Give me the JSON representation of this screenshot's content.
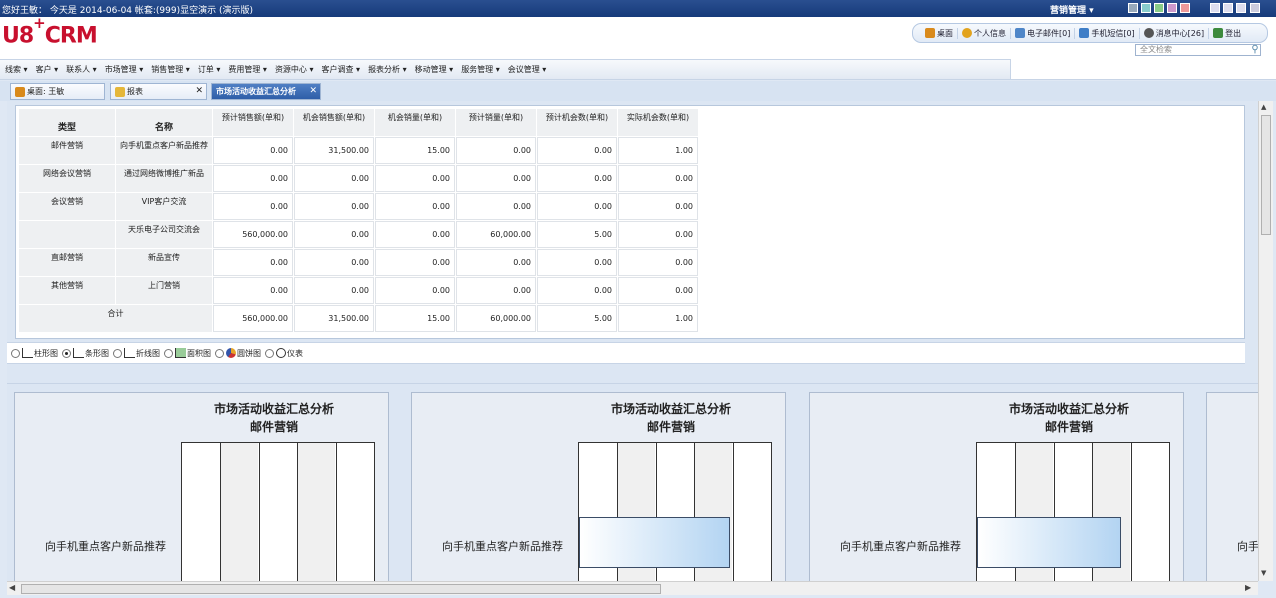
{
  "titlebar": {
    "welcome": "您好王敏：  今天是  2014-06-04 帐套:(999)显空演示 (演示版)",
    "mode": "营销管理"
  },
  "header": {
    "logo_a": "U8",
    "logo_plus": "+",
    "logo_b": "CRM",
    "tools": [
      {
        "label": "桌面",
        "icon": "home-icon",
        "color": "#d98a1c"
      },
      {
        "label": "个人信息",
        "icon": "user-icon",
        "color": "#e2a31d"
      },
      {
        "label": "电子邮件[0]",
        "icon": "mail-icon",
        "color": "#4f86c8"
      },
      {
        "label": "手机短信[0]",
        "icon": "phone-icon",
        "color": "#3f7ec7"
      },
      {
        "label": "消息中心[26]",
        "icon": "message-icon",
        "color": "#555555"
      },
      {
        "label": "登出",
        "icon": "logout-icon",
        "color": "#3d8a3d"
      }
    ],
    "search_placeholder": "全文检索"
  },
  "menu": [
    "线索 ▾",
    "客户 ▾",
    "联系人 ▾",
    "市场管理 ▾",
    "销售管理 ▾",
    "订单 ▾",
    "费用管理 ▾",
    "资源中心 ▾",
    "客户调查 ▾",
    "报表分析 ▾",
    "移动管理 ▾",
    "服务管理 ▾",
    "会议管理 ▾"
  ],
  "tabs": [
    {
      "label": "桌面: 王敏"
    },
    {
      "label": "报表"
    },
    {
      "label": "市场活动收益汇总分析"
    }
  ],
  "table": {
    "h_type": "类型",
    "h_name": "名称",
    "columns": [
      "预计销售额(单和)",
      "机会销售额(单和)",
      "机会销量(单和)",
      "预计销量(单和)",
      "预计机会数(单和)",
      "实际机会数(单和)"
    ],
    "rows": [
      {
        "type": "邮件营销",
        "name": "向手机重点客户新品推荐",
        "values": [
          "0.00",
          "31,500.00",
          "15.00",
          "0.00",
          "0.00",
          "1.00"
        ]
      },
      {
        "type": "网络会议营销",
        "name": "通过网络微博推广新品",
        "values": [
          "0.00",
          "0.00",
          "0.00",
          "0.00",
          "0.00",
          "0.00"
        ]
      },
      {
        "type": "会议营销",
        "name": "VIP客户交流",
        "values": [
          "0.00",
          "0.00",
          "0.00",
          "0.00",
          "0.00",
          "0.00"
        ]
      },
      {
        "type": "",
        "name": "天乐电子公司交流会",
        "values": [
          "560,000.00",
          "0.00",
          "0.00",
          "60,000.00",
          "5.00",
          "0.00"
        ]
      },
      {
        "type": "直邮营销",
        "name": "新品宣传",
        "values": [
          "0.00",
          "0.00",
          "0.00",
          "0.00",
          "0.00",
          "0.00"
        ]
      },
      {
        "type": "其他营销",
        "name": "上门营销",
        "values": [
          "0.00",
          "0.00",
          "0.00",
          "0.00",
          "0.00",
          "0.00"
        ]
      }
    ],
    "total_label": "合计",
    "total": [
      "560,000.00",
      "31,500.00",
      "15.00",
      "60,000.00",
      "5.00",
      "1.00"
    ]
  },
  "chart_types": [
    {
      "label": "柱形图",
      "icon": "column-chart-icon",
      "selected": false
    },
    {
      "label": "条形图",
      "icon": "bar-chart-icon",
      "selected": true
    },
    {
      "label": "折线图",
      "icon": "line-chart-icon",
      "selected": false
    },
    {
      "label": "面积图",
      "icon": "area-chart-icon",
      "selected": false
    },
    {
      "label": "圆饼图",
      "icon": "pie-chart-icon",
      "selected": false
    },
    {
      "label": "仪表",
      "icon": "gauge-icon",
      "selected": false
    }
  ],
  "chart_data": [
    {
      "type": "bar",
      "title": "市场活动收益汇总分析",
      "subtitle": "邮件营销",
      "categories": [
        "向手机重点客户新品推荐"
      ],
      "values": [
        0
      ],
      "xlim": [
        0,
        1
      ]
    },
    {
      "type": "bar",
      "title": "市场活动收益汇总分析",
      "subtitle": "邮件营销",
      "categories": [
        "向手机重点客户新品推荐"
      ],
      "values": [
        31500
      ],
      "xlim": [
        0,
        40000
      ]
    },
    {
      "type": "bar",
      "title": "市场活动收益汇总分析",
      "subtitle": "邮件营销",
      "categories": [
        "向手机重点客户新品推荐"
      ],
      "values": [
        15
      ],
      "xlim": [
        0,
        20
      ]
    },
    {
      "type": "bar",
      "title": "",
      "subtitle": "",
      "categories": [
        "向手机重点客户新品推荐"
      ],
      "values": [
        0
      ],
      "xlim": [
        0,
        1
      ]
    }
  ]
}
